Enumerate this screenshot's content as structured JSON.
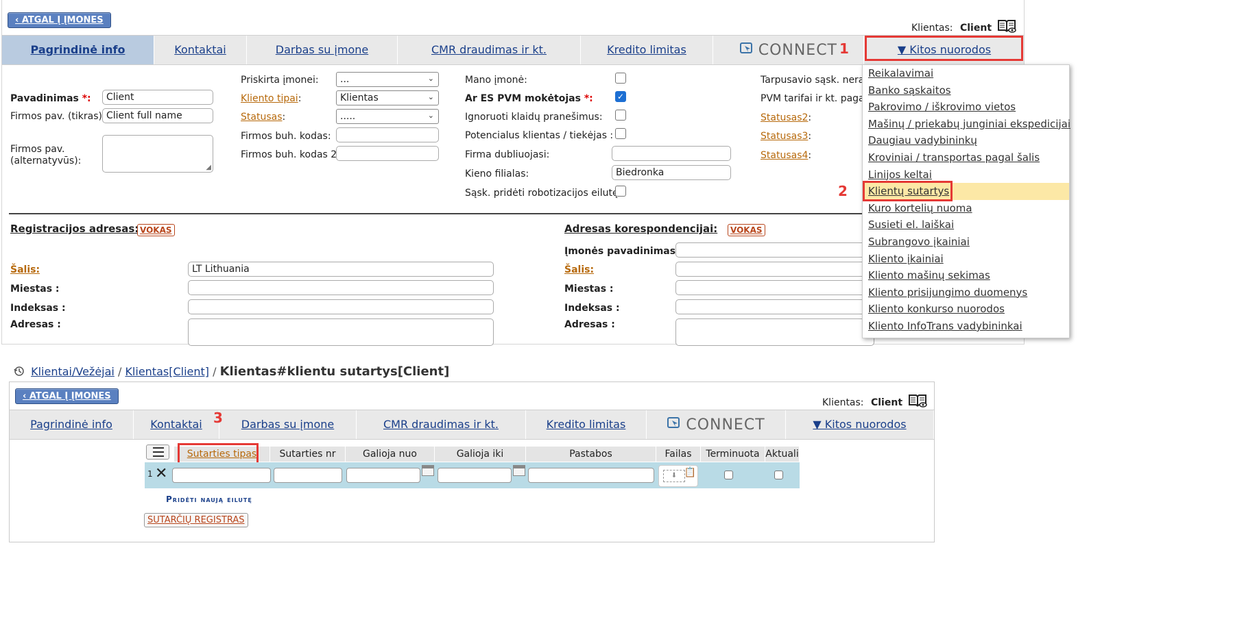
{
  "top_panel": {
    "back_button": "‹ ATGAL Į ĮMONES",
    "client_label": "Klientas:",
    "client_value": "Client",
    "book_icon": "book-eye-icon",
    "tabs": [
      {
        "label": "Pagrindinė info",
        "active": true
      },
      {
        "label": "Kontaktai",
        "active": false
      },
      {
        "label": "Darbas su įmone",
        "active": false
      },
      {
        "label": "CMR draudimas ir kt.",
        "active": false
      },
      {
        "label": "Kredito limitas",
        "active": false
      }
    ],
    "connect_label": "CONNECT",
    "other_links": "▼ Kitos nuorodos",
    "form": {
      "pavadinimas": {
        "label": "Pavadinimas",
        "req": "*:",
        "value": "Client"
      },
      "firmos_pav": {
        "label": "Firmos pav. (tikras):",
        "value": "Client full name"
      },
      "firmos_alt": {
        "label1": "Firmos pav.",
        "label2": "(alternatyvūs):"
      },
      "priskirta": {
        "label": "Priskirta įmonei:",
        "value": "..."
      },
      "kliento_tipai": {
        "label": "Kliento tipai",
        "colon": ":",
        "value": "Klientas"
      },
      "statusas": {
        "label": "Statusas",
        "colon": ":",
        "value": "....."
      },
      "buh_kodas": {
        "label": "Firmos buh. kodas:"
      },
      "buh_kodas2": {
        "label": "Firmos buh. kodas 2:"
      },
      "mano_imone": {
        "label": "Mano įmonė:"
      },
      "es_pvm": {
        "label": "Ar ES PVM mokėtojas",
        "req": "*:"
      },
      "ignoruoti": {
        "label": "Ignoruoti klaidų pranešimus:"
      },
      "potencialus": {
        "label": "Potencialus klientas / tiekėjas :"
      },
      "dubliuojasi": {
        "label": "Firma dubliuojasi:"
      },
      "filialas": {
        "label": "Kieno filialas:",
        "value": "Biedronka"
      },
      "robotizacija": {
        "label": "Sąsk. pridėti robotizacijos eilutę:"
      },
      "tarpusavio": {
        "label": "Tarpusavio sąsk. nerašo"
      },
      "pvm_tarifai": {
        "label": "PVM tarifai ir kt. pagal į"
      },
      "statusas2": {
        "label": "Statusas2",
        "colon": ":"
      },
      "statusas3": {
        "label": "Statusas3",
        "colon": ":"
      },
      "statusas4": {
        "label": "Statusas4",
        "colon": ":"
      }
    },
    "reg_address": {
      "title": "Registracijos adresas:",
      "vokas": "VOKAS",
      "salis_label": "Šalis:",
      "salis_value": "LT Lithuania",
      "miestas": "Miestas :",
      "indeksas": "Indeksas :",
      "adresas": "Adresas :"
    },
    "corr_address": {
      "title": "Adresas korespondencijai:",
      "vokas": "VOKAS",
      "imones_pav": "Įmonės pavadinimas :",
      "salis_label": "Šalis:",
      "miestas": "Miestas :",
      "indeksas": "Indeksas :",
      "adresas": "Adresas :"
    },
    "dropdown_items": [
      "Reikalavimai",
      "Banko sąskaitos",
      "Pakrovimo / iškrovimo vietos",
      "Mašinų / priekabų junginiai ekspedicijai",
      "Daugiau vadybininkų",
      "Kroviniai / transportas pagal šalis",
      "Linijos keltai",
      "Klientų sutartys",
      "Kuro kortelių nuoma",
      "Susieti el. laiškai",
      "Subrangovo įkainiai",
      "Kliento įkainiai",
      "Kliento mašinų sekimas",
      "Kliento prisijungimo duomenys",
      "Kliento konkurso nuorodos",
      "Kliento InfoTrans vadybininkai"
    ],
    "highlighted_item": 7,
    "callout_1": "1",
    "callout_2": "2"
  },
  "bottom_panel": {
    "breadcrumb": {
      "history_icon": "history-icon",
      "crumb1": "Klientai/Vežėjai",
      "sep": "/",
      "crumb2": "Klientas[Client]",
      "current": "Klientas#klientu sutartys[Client]"
    },
    "back_button": "‹ ATGAL Į ĮMONES",
    "client_label": "Klientas:",
    "client_value": "Client",
    "tabs": [
      "Pagrindinė info",
      "Kontaktai",
      "Darbas su įmone",
      "CMR draudimas ir kt.",
      "Kredito limitas"
    ],
    "connect_label": "CONNECT",
    "other_links": "▼ Kitos nuorodos",
    "columns": [
      "Sutarties tipas",
      "Sutarties nr",
      "Galioja nuo",
      "Galioja iki",
      "Pastabos",
      "Failas",
      "Terminuota",
      "Aktuali"
    ],
    "row_number": "1",
    "add_row": "Pridėti naują eilutę",
    "registry_button": "SUTARČIŲ REGISTRAS",
    "callout_3": "3"
  },
  "colors": {
    "accent_blue": "#5a80c0",
    "link": "#1a3f8a",
    "callout_red": "#e53935",
    "active_tab": "#b9cbe0",
    "grid_row": "#b9dbe6",
    "menu_highlight": "#fce8a6"
  }
}
